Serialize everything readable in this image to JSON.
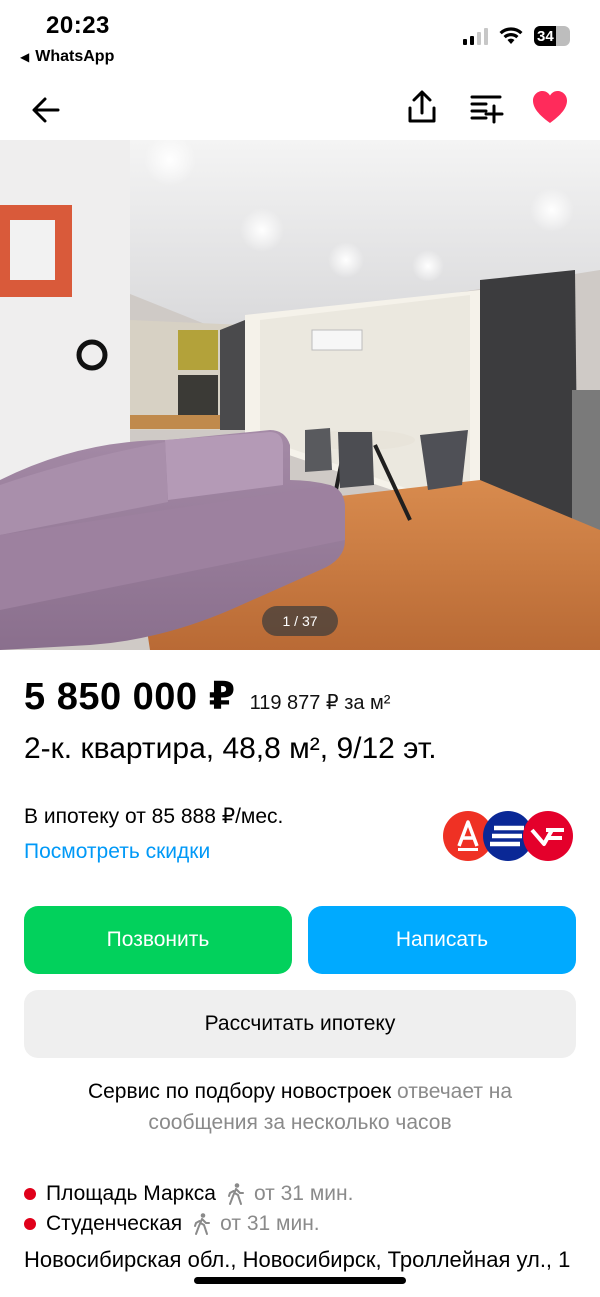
{
  "status": {
    "time": "20:23",
    "back_app": "WhatsApp",
    "battery": "34"
  },
  "gallery": {
    "counter": "1 / 37"
  },
  "listing": {
    "price": "5 850 000 ₽",
    "price_per_m2": "119 877 ₽ за м²",
    "title": "2-к. квартира, 48,8 м², 9/12 эт.",
    "mortgage": "В ипотеку от 85 888 ₽/мес.",
    "discounts_link": "Посмотреть скидки"
  },
  "actions": {
    "call": "Позвонить",
    "write": "Написать",
    "calc": "Рассчитать ипотеку"
  },
  "seller_note": {
    "main": "Сервис по подбору новостроек",
    "muted": " отвечает на сообщения за несколько часов"
  },
  "metro": [
    {
      "name": "Площадь Маркса",
      "time": "от 31 мин."
    },
    {
      "name": "Студенческая",
      "time": "от 31 мин."
    }
  ],
  "address": "Новосибирская обл., Новосибирск, Троллейная ул., 1",
  "colors": {
    "call": "#02d15c",
    "write": "#00aaff",
    "link": "#0099f7",
    "favorite": "#ff2b5b",
    "metro_dot": "#e0001a"
  },
  "icons": {
    "back": "arrow-left-icon",
    "share": "share-icon",
    "compare": "compare-icon",
    "favorite": "heart-icon",
    "walk": "walking-person-icon"
  }
}
